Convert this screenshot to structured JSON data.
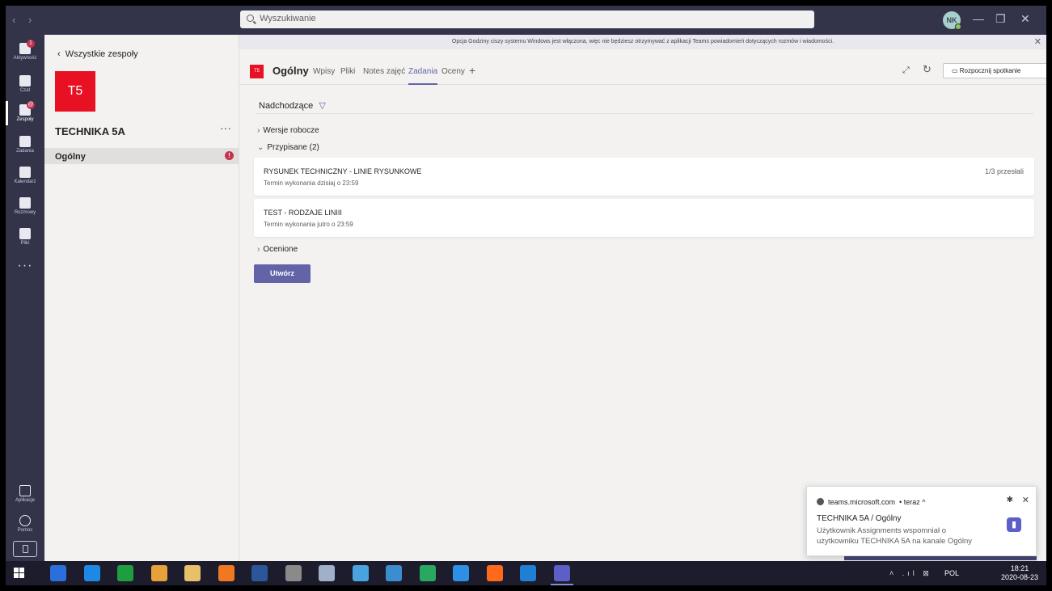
{
  "titlebar": {
    "search_placeholder": "Wyszukiwanie",
    "avatar_initials": "NK",
    "window_controls": [
      "—",
      "❐",
      "✕"
    ]
  },
  "rail": {
    "items": [
      {
        "label": "Aktywność",
        "badge": "1",
        "icon": "bell-icon"
      },
      {
        "label": "Czat",
        "badge": "",
        "icon": "chat-icon"
      },
      {
        "label": "Zespoły",
        "badge": "@",
        "icon": "teams-icon"
      },
      {
        "label": "Zadania",
        "badge": "",
        "icon": "assignments-icon"
      },
      {
        "label": "Kalendarz",
        "badge": "",
        "icon": "calendar-icon"
      },
      {
        "label": "Rozmowy",
        "badge": "",
        "icon": "phone-icon"
      },
      {
        "label": "Pliki",
        "badge": "",
        "icon": "files-icon"
      }
    ],
    "more": "···",
    "apps_label": "Aplikacje",
    "help_label": "Pomoc"
  },
  "teampanel": {
    "back_label": "Wszystkie zespoły",
    "tile_initials": "T5",
    "team_name": "TECHNIKA 5A",
    "more": "···",
    "channels": [
      {
        "name": "Ogólny",
        "badge": "!"
      }
    ]
  },
  "notice": "Opcja Godziny ciszy systemu Windows jest włączona, więc nie będziesz otrzymywać z aplikacji Teams powiadomień dotyczących rozmów i wiadomości.",
  "channel_header": {
    "tile": "T5",
    "title": "Ogólny",
    "tabs": [
      "Wpisy",
      "Pliki",
      "Notes zajęć",
      "Zadania",
      "Oceny",
      "+"
    ],
    "active_tab": "Zadania",
    "meet_button": "Rozpocznij spotkanie"
  },
  "assignments": {
    "upcoming_label": "Nadchodzące",
    "drafts_label": "Wersje robocze",
    "assigned_label": "Przypisane",
    "assigned_count": "(2)",
    "graded_label": "Ocenione",
    "items": [
      {
        "title": "RYSUNEK TECHNICZNY - LINIE RYSUNKOWE",
        "due": "Termin wykonania dzisiaj o 23:59",
        "status": "1/3 przesłali"
      },
      {
        "title": "TEST - RODZAJE LINIII",
        "due": "Termin wykonania jutro o 23:59",
        "status": ""
      }
    ],
    "create_button": "Utwórz"
  },
  "toast": {
    "source": "teams.microsoft.com",
    "time": "• teraz ^",
    "title": "TECHNIKA 5A / Ogólny",
    "body": "Użytkownik Assignments wspomniał o użytkowniku TECHNIKA 5A na kanale Ogólny"
  },
  "taskbar": {
    "lang": "POL",
    "time": "18:21",
    "date": "2020-08-23",
    "apps": [
      {
        "name": "explorer-app",
        "color": "#2a6fdb"
      },
      {
        "name": "photo-app",
        "color": "#1e88e5"
      },
      {
        "name": "store-app",
        "color": "#1e9e3e"
      },
      {
        "name": "chrome-app",
        "color": "#e8a03a"
      },
      {
        "name": "files-app",
        "color": "#e8c06a"
      },
      {
        "name": "avast-app",
        "color": "#f07820"
      },
      {
        "name": "word-app",
        "color": "#2b579a"
      },
      {
        "name": "notes-app",
        "color": "#8a8a8a"
      },
      {
        "name": "settings-app",
        "color": "#9fb0c8"
      },
      {
        "name": "paint-app",
        "color": "#4aa3df"
      },
      {
        "name": "calculator-app",
        "color": "#3c8dd0"
      },
      {
        "name": "images-app",
        "color": "#2aa860"
      },
      {
        "name": "ie-app",
        "color": "#2d8fe6"
      },
      {
        "name": "firefox-app",
        "color": "#ff6a1a"
      },
      {
        "name": "edge-app",
        "color": "#1f7fd4"
      },
      {
        "name": "teams-app",
        "color": "#5b5fc7"
      }
    ]
  },
  "colors": {
    "accent": "#6264a7",
    "rail": "#33344a",
    "team_tile": "#e81123",
    "badge": "#c4314b"
  }
}
